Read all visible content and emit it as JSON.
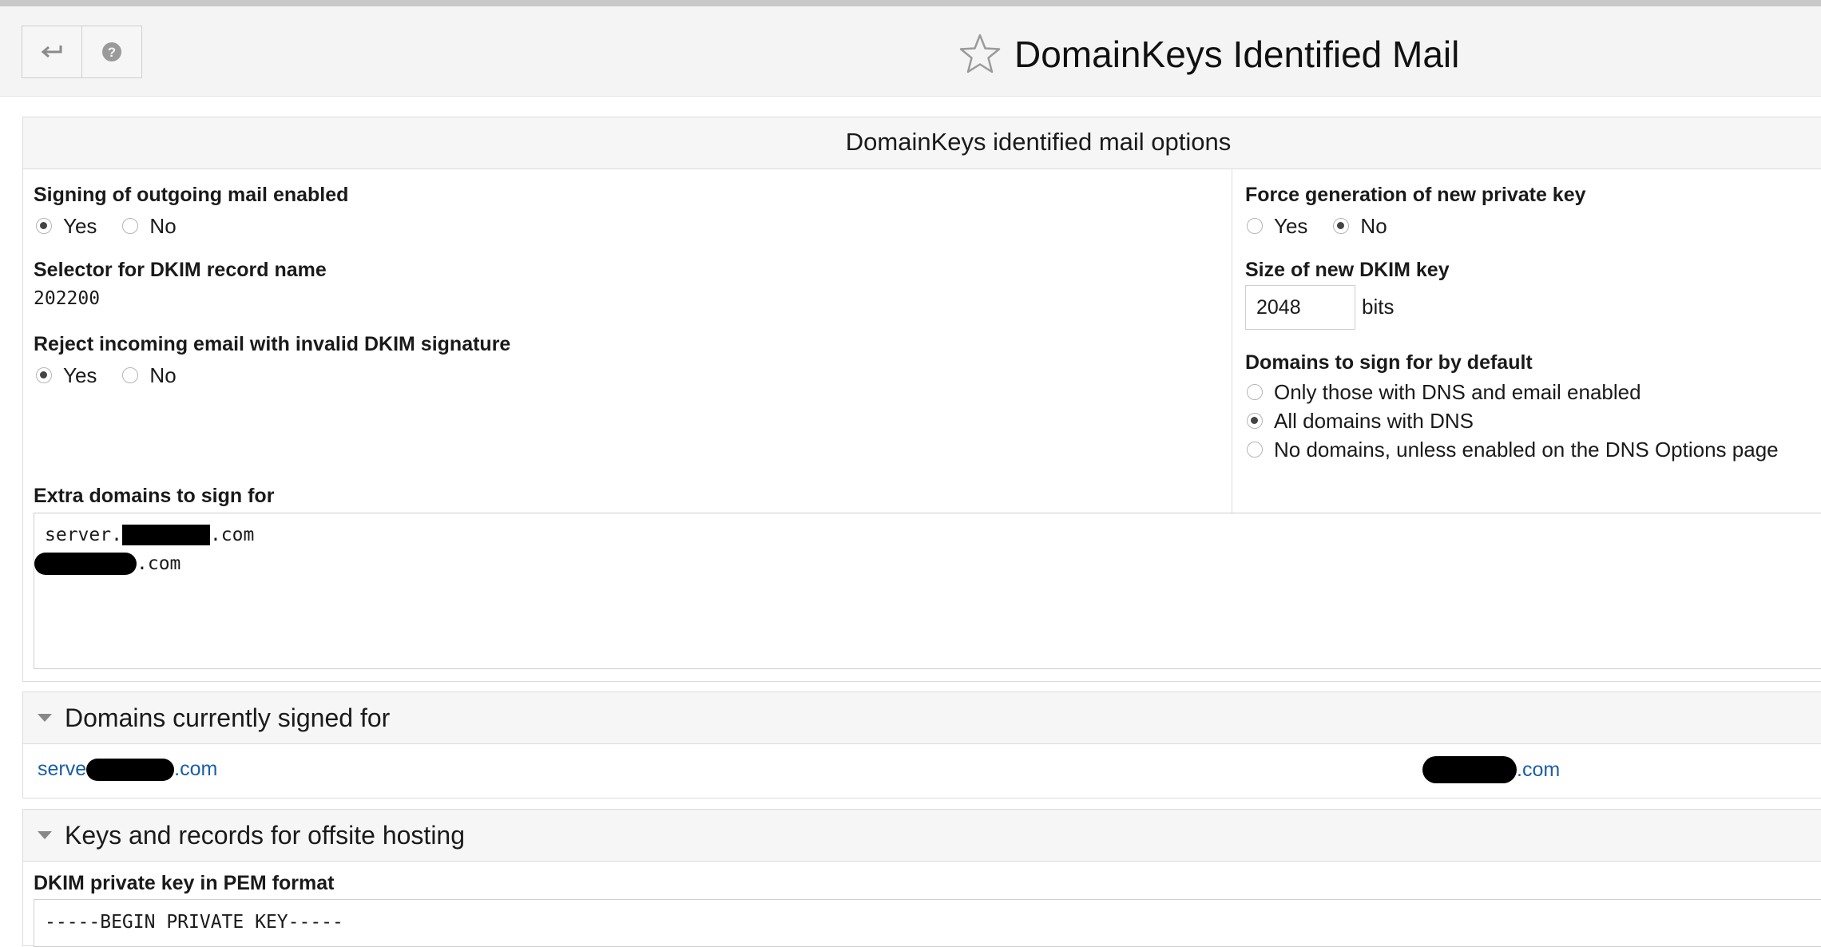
{
  "header": {
    "back_icon": "return-arrow-icon",
    "help_icon": "help-circle-icon",
    "star_icon": "star-outline-icon",
    "title": "DomainKeys Identified Mail"
  },
  "options": {
    "title": "DomainKeys identified mail options",
    "signing": {
      "label": "Signing of outgoing mail enabled",
      "yes": "Yes",
      "no": "No",
      "selected": "Yes"
    },
    "selector": {
      "label": "Selector for DKIM record name",
      "value": "202200"
    },
    "reject": {
      "label": "Reject incoming email with invalid DKIM signature",
      "yes": "Yes",
      "no": "No",
      "selected": "Yes"
    },
    "force": {
      "label": "Force generation of new private key",
      "yes": "Yes",
      "no": "No",
      "selected": "No"
    },
    "keysize": {
      "label": "Size of new DKIM key",
      "value": "2048",
      "unit": "bits"
    },
    "domains_default": {
      "label": "Domains to sign for by default",
      "options": [
        "Only those with DNS and email enabled",
        "All domains with DNS",
        "No domains, unless enabled on the DNS Options page"
      ],
      "selected": "All domains with DNS"
    },
    "extra": {
      "label": "Extra domains to sign for",
      "line1_prefix": "server.",
      "line1_suffix": ".com",
      "line2_suffix": ".com"
    }
  },
  "signed": {
    "title": "Domains currently signed for",
    "link1_prefix": "serve",
    "link1_suffix": ".com",
    "link2_suffix": ".com"
  },
  "offsite": {
    "title": "Keys and records for offsite hosting",
    "pem_label": "DKIM private key in PEM format",
    "pem_first_line": "-----BEGIN PRIVATE KEY-----"
  }
}
